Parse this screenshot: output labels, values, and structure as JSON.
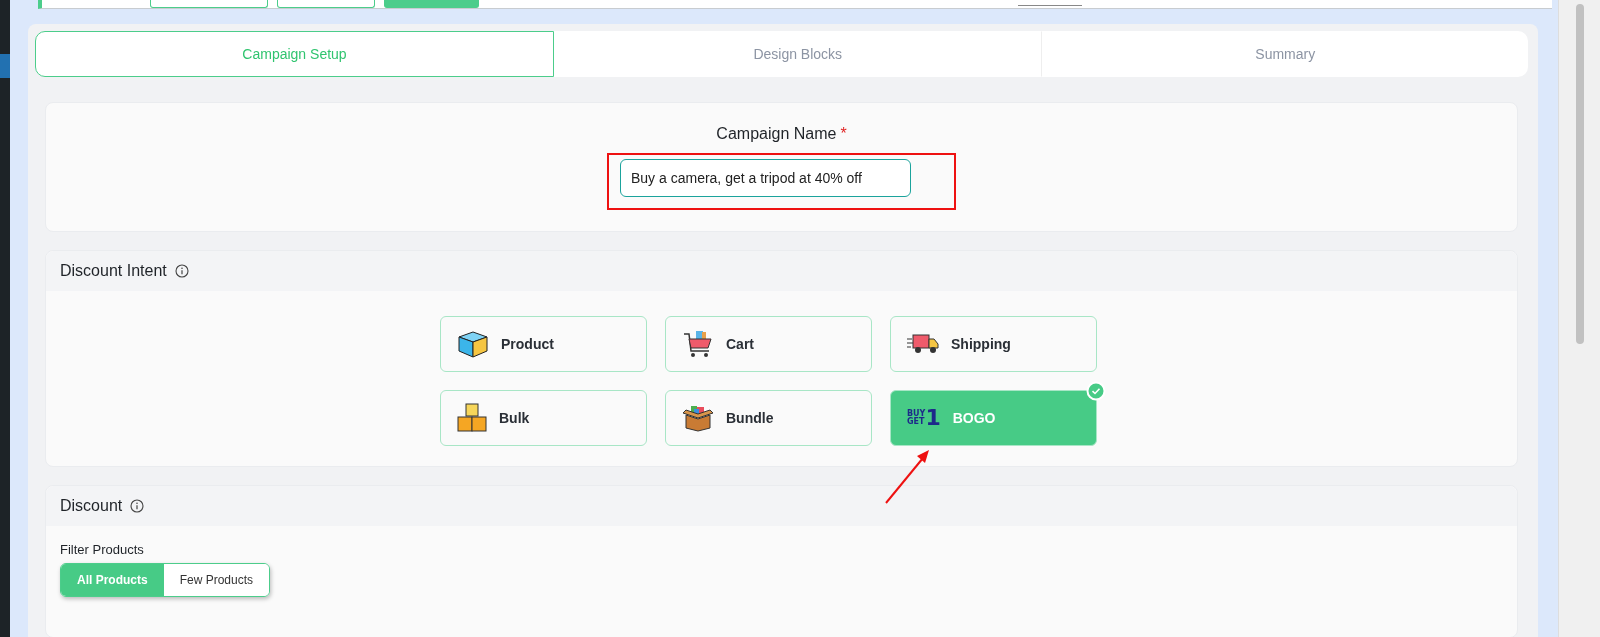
{
  "top_bar": {
    "buttons": [
      {
        "kind": "outline"
      },
      {
        "kind": "outline"
      },
      {
        "kind": "filled"
      }
    ]
  },
  "tabs": [
    {
      "label": "Campaign Setup",
      "selected": true
    },
    {
      "label": "Design Blocks",
      "selected": false
    },
    {
      "label": "Summary",
      "selected": false
    }
  ],
  "campaign_name": {
    "label": "Campaign Name",
    "required_mark": "*",
    "value": "Buy a camera, get a tripod at 40% off",
    "highlighted": true
  },
  "discount_intent": {
    "title": "Discount Intent",
    "options": [
      {
        "label": "Product",
        "kind": "box",
        "selected": false
      },
      {
        "label": "Cart",
        "kind": "cart",
        "selected": false
      },
      {
        "label": "Shipping",
        "kind": "truck",
        "selected": false
      },
      {
        "label": "Bulk",
        "kind": "boxes",
        "selected": false
      },
      {
        "label": "Bundle",
        "kind": "bundle",
        "selected": false
      },
      {
        "label": "BOGO",
        "kind": "bogo",
        "selected": true,
        "icon_text": [
          "BUY",
          "GET",
          "1"
        ]
      }
    ]
  },
  "discount": {
    "title": "Discount",
    "filter_label": "Filter Products",
    "filter_options": [
      {
        "label": "All Products",
        "selected": true
      },
      {
        "label": "Few Products",
        "selected": false
      }
    ]
  }
}
